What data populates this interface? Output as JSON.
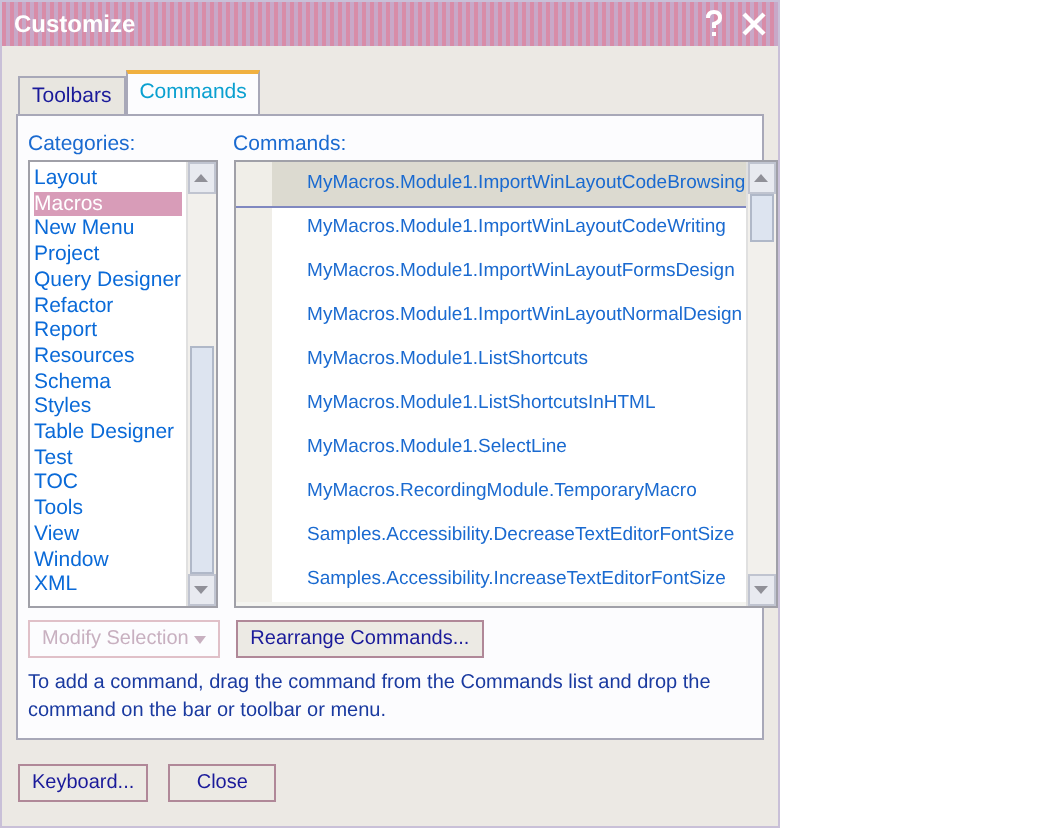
{
  "window": {
    "title": "Customize"
  },
  "tabs": [
    {
      "label": "Toolbars",
      "selected": false
    },
    {
      "label": "Commands",
      "selected": true
    }
  ],
  "categories": {
    "label": "Categories:",
    "items": [
      {
        "label": "Layout",
        "selected": false
      },
      {
        "label": "Macros",
        "selected": true
      },
      {
        "label": "New Menu",
        "selected": false
      },
      {
        "label": "Project",
        "selected": false
      },
      {
        "label": "Query Designer",
        "selected": false
      },
      {
        "label": "Refactor",
        "selected": false
      },
      {
        "label": "Report",
        "selected": false
      },
      {
        "label": "Resources",
        "selected": false
      },
      {
        "label": "Schema",
        "selected": false
      },
      {
        "label": "Styles",
        "selected": false
      },
      {
        "label": "Table Designer",
        "selected": false
      },
      {
        "label": "Test",
        "selected": false
      },
      {
        "label": "TOC",
        "selected": false
      },
      {
        "label": "Tools",
        "selected": false
      },
      {
        "label": "View",
        "selected": false
      },
      {
        "label": "Window",
        "selected": false
      },
      {
        "label": "XML",
        "selected": false
      }
    ]
  },
  "commands": {
    "label": "Commands:",
    "items": [
      {
        "label": "MyMacros.Module1.ImportWinLayoutCodeBrowsing",
        "selected": true
      },
      {
        "label": "MyMacros.Module1.ImportWinLayoutCodeWriting",
        "selected": false
      },
      {
        "label": "MyMacros.Module1.ImportWinLayoutFormsDesign",
        "selected": false
      },
      {
        "label": "MyMacros.Module1.ImportWinLayoutNormalDesign",
        "selected": false
      },
      {
        "label": "MyMacros.Module1.ListShortcuts",
        "selected": false
      },
      {
        "label": "MyMacros.Module1.ListShortcutsInHTML",
        "selected": false
      },
      {
        "label": "MyMacros.Module1.SelectLine",
        "selected": false
      },
      {
        "label": "MyMacros.RecordingModule.TemporaryMacro",
        "selected": false
      },
      {
        "label": "Samples.Accessibility.DecreaseTextEditorFontSize",
        "selected": false
      },
      {
        "label": "Samples.Accessibility.IncreaseTextEditorFontSize",
        "selected": false
      }
    ]
  },
  "modify_selection": {
    "label": "Modify Selection",
    "disabled": true
  },
  "rearrange_button": {
    "label": "Rearrange Commands..."
  },
  "description": "To add a command, drag the command from the Commands list and drop the command on the bar or toolbar or menu.",
  "buttons": [
    "Keyboard...",
    "Close"
  ]
}
